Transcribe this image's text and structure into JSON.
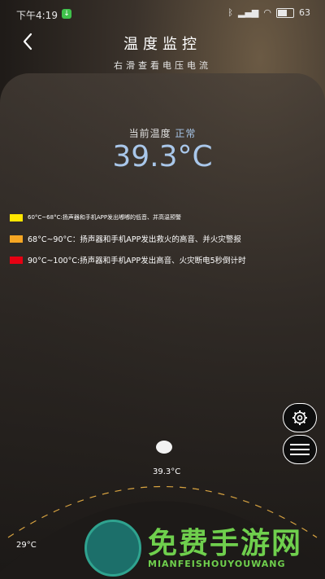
{
  "status_bar": {
    "time": "下午4:19",
    "battery": "63"
  },
  "header": {
    "title": "温度监控",
    "subtitle": "右滑查看电压电流"
  },
  "current": {
    "label": "当前温度",
    "status": "正常",
    "temperature": "39.3°C"
  },
  "legend": [
    {
      "color": "#ffe600",
      "text": "60°C~68°C:扬声器和手机APP发出嘟嘟的低音、并高温预警"
    },
    {
      "color": "#f5a623",
      "text": "68°C~90°C：扬声器和手机APP发出救火的高音、并火灾警报"
    },
    {
      "color": "#e60012",
      "text": "90°C~100°C:扬声器和手机APP发出高音、火灾断电5秒倒计时"
    }
  ],
  "gauge": {
    "value_label": "39.3°C",
    "min_label": "29°C"
  },
  "watermark": {
    "title": "免费手游网",
    "subtitle": "MIANFEISHOUYOUWANG"
  }
}
